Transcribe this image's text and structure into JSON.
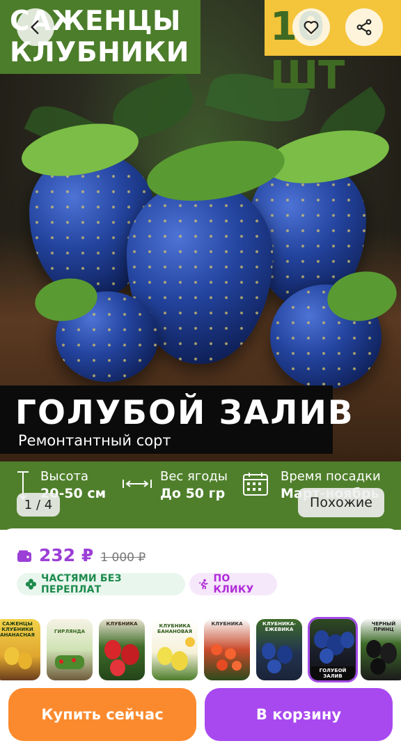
{
  "hero": {
    "title_line1": "САЖЕНЦЫ",
    "title_line2": "КЛУБНИКИ",
    "quantity": "10 ШТ",
    "variety_name": "ГОЛУБОЙ ЗАЛИВ",
    "variety_subtitle": "Ремонтантный сорт",
    "specs": [
      {
        "label": "Высота",
        "value": "20-50 см",
        "icon": "height-icon"
      },
      {
        "label": "Вес ягоды",
        "value": "До 50 гр",
        "icon": "weight-arrows-icon"
      },
      {
        "label": "Время посадки",
        "value": "Март-ноябрь",
        "icon": "calendar-icon"
      }
    ],
    "pager": "1 / 4",
    "similar_label": "Похожие"
  },
  "top_actions": {
    "back": "back-chevron-icon",
    "favorite": "heart-icon",
    "share": "share-icon"
  },
  "price": {
    "current": "232 ₽",
    "old": "1 000 ₽"
  },
  "badges": [
    {
      "text": "ЧАСТЯМИ БЕЗ ПЕРЕПЛАТ",
      "icon": "clover-icon",
      "color": "#1d8a4c"
    },
    {
      "text": "ПО КЛИКУ",
      "icon": "runner-icon",
      "color": "#b02bd8"
    }
  ],
  "thumbnails": [
    {
      "caption": "САЖЕНЦЫ КЛУБНИКИ АНАНАСНАЯ"
    },
    {
      "caption": "ГИРЛЯНДА"
    },
    {
      "caption": "КЛУБНИКА"
    },
    {
      "caption": "КЛУБНИКА БАНАНОВАЯ"
    },
    {
      "caption": "КЛУБНИКА"
    },
    {
      "caption": "КЛУБНИКА-ЕЖЕВИКА"
    },
    {
      "caption": "ГОЛУБОЙ ЗАЛИВ"
    },
    {
      "caption": "ЧЕРНЫЙ ПРИНЦ"
    }
  ],
  "buttons": {
    "buy_now": "Купить сейчас",
    "add_to_cart": "В корзину"
  },
  "colors": {
    "accent_purple": "#a849f0",
    "accent_orange": "#fb8a2e",
    "price_purple": "#9b3fd6",
    "hero_green": "#4f7f2b",
    "badge_yellow": "#f4c43a"
  }
}
